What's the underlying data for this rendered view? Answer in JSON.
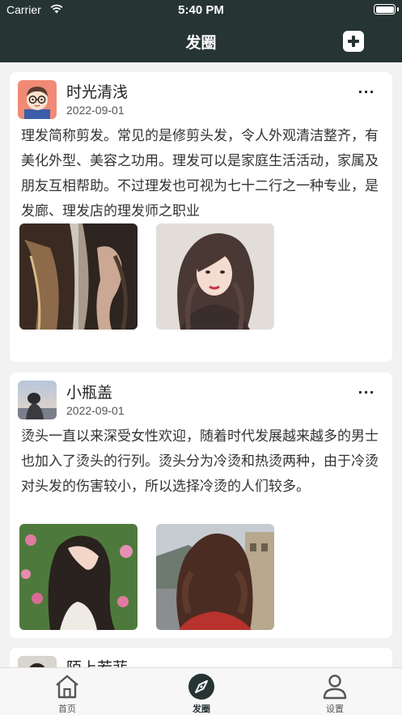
{
  "status_bar": {
    "carrier": "Carrier",
    "time": "5:40 PM"
  },
  "nav": {
    "title": "发圈",
    "add_icon": "plus-square-icon"
  },
  "posts": [
    {
      "user": "时光清浅",
      "date": "2022-09-01",
      "text": "理发简称剪发。常见的是修剪头发，令人外观清洁整齐，有美化外型、美容之功用。理发可以是家庭生活活动，家属及朋友互相帮助。不过理发也可视为七十二行之一种专业，是发廊、理发店的理发师之职业",
      "more": "···"
    },
    {
      "user": "小瓶盖",
      "date": "2022-09-01",
      "text": "烫头一直以来深受女性欢迎，随着时代发展越来越多的男士也加入了烫头的行列。烫头分为冷烫和热烫两种，由于冷烫对头发的伤害较小，所以选择冷烫的人们较多。",
      "more": "···"
    },
    {
      "user": "陌上若菲"
    }
  ],
  "tabbar": [
    {
      "label": "首页",
      "icon": "home-icon"
    },
    {
      "label": "发圈",
      "icon": "compass-icon"
    },
    {
      "label": "设置",
      "icon": "user-icon"
    }
  ],
  "colors": {
    "header": "#263433",
    "background": "#f2f2f2"
  }
}
